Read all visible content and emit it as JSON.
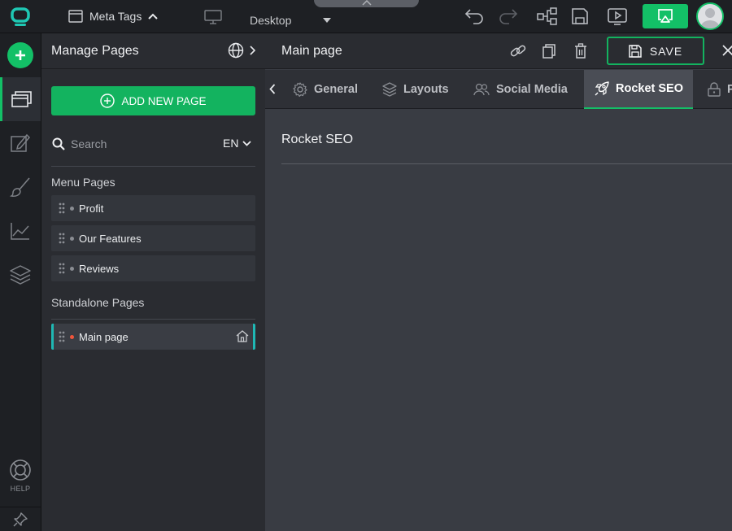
{
  "topbar": {
    "meta_tags_label": "Meta Tags",
    "device_label": "Desktop",
    "icons": [
      "app-logo-icon",
      "window-icon",
      "chevron-up-icon",
      "monitor-icon",
      "caret-down-icon",
      "undo-icon",
      "redo-icon",
      "sitemap-icon",
      "save-disk-icon",
      "preview-play-icon",
      "publish-cast-icon",
      "avatar-icon"
    ],
    "accent_color": "#13c067"
  },
  "rail": {
    "icons": [
      "add-icon",
      "pages-icon",
      "edit-icon",
      "brush-icon",
      "analytics-icon",
      "layers-icon",
      "help-lifebuoy-icon",
      "pin-icon"
    ],
    "help_label": "HELP"
  },
  "manage_pages": {
    "title": "Manage Pages",
    "add_button_label": "ADD NEW PAGE",
    "search_placeholder": "Search",
    "language": "EN",
    "menu_section_label": "Menu Pages",
    "menu_pages": [
      {
        "label": "Profit"
      },
      {
        "label": "Our Features"
      },
      {
        "label": "Reviews"
      }
    ],
    "standalone_section_label": "Standalone Pages",
    "standalone_pages": [
      {
        "label": "Main page",
        "active": true
      }
    ]
  },
  "editor": {
    "page_title": "Main page",
    "save_label": "SAVE",
    "tabs": [
      {
        "label": "General",
        "icon": "gear-icon"
      },
      {
        "label": "Layouts",
        "icon": "layers-icon"
      },
      {
        "label": "Social Media",
        "icon": "users-icon"
      },
      {
        "label": "Rocket SEO",
        "icon": "rocket-icon",
        "active": true
      },
      {
        "label": "P",
        "icon": "lock-icon"
      }
    ],
    "section_title": "Rocket SEO"
  }
}
